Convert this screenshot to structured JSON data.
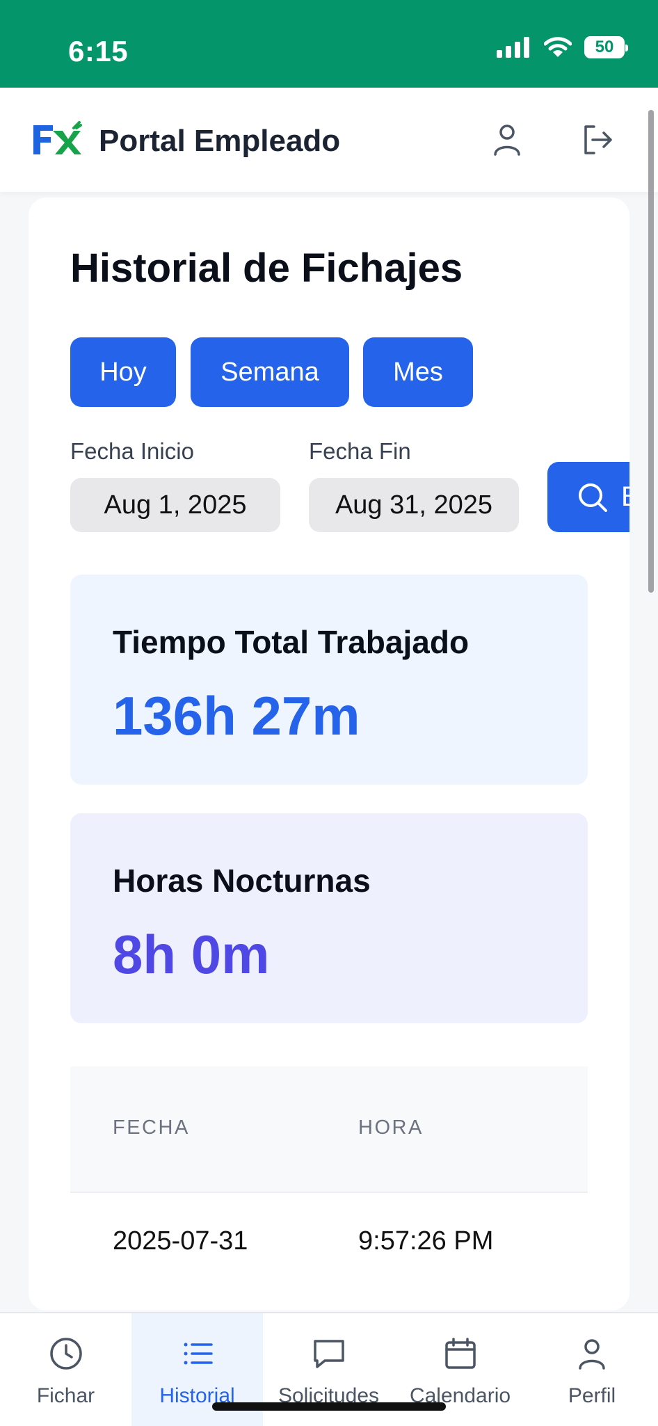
{
  "status": {
    "time": "6:15",
    "battery": "50"
  },
  "header": {
    "title": "Portal Empleado",
    "logo": "FX"
  },
  "page": {
    "title": "Historial de Fichajes"
  },
  "filters": [
    "Hoy",
    "Semana",
    "Mes"
  ],
  "dates": {
    "start_label": "Fecha Inicio",
    "start_value": "Aug 1, 2025",
    "end_label": "Fecha Fin",
    "end_value": "Aug 31, 2025"
  },
  "search": {
    "label": "Bu"
  },
  "stats": [
    {
      "title": "Tiempo Total Trabajado",
      "value": "136h 27m"
    },
    {
      "title": "Horas Nocturnas",
      "value": "8h 0m"
    }
  ],
  "table": {
    "columns": [
      "FECHA",
      "HORA"
    ],
    "rows": [
      [
        "2025-07-31",
        "9:57:26 PM"
      ]
    ]
  },
  "nav": [
    {
      "label": "Fichar",
      "icon": "clock-icon"
    },
    {
      "label": "Historial",
      "icon": "list-icon"
    },
    {
      "label": "Solicitudes",
      "icon": "chat-icon"
    },
    {
      "label": "Calendario",
      "icon": "calendar-icon"
    },
    {
      "label": "Perfil",
      "icon": "user-icon"
    }
  ],
  "colors": {
    "status_bar": "#05956a",
    "accent": "#2563eb",
    "purple": "#5048e5"
  }
}
